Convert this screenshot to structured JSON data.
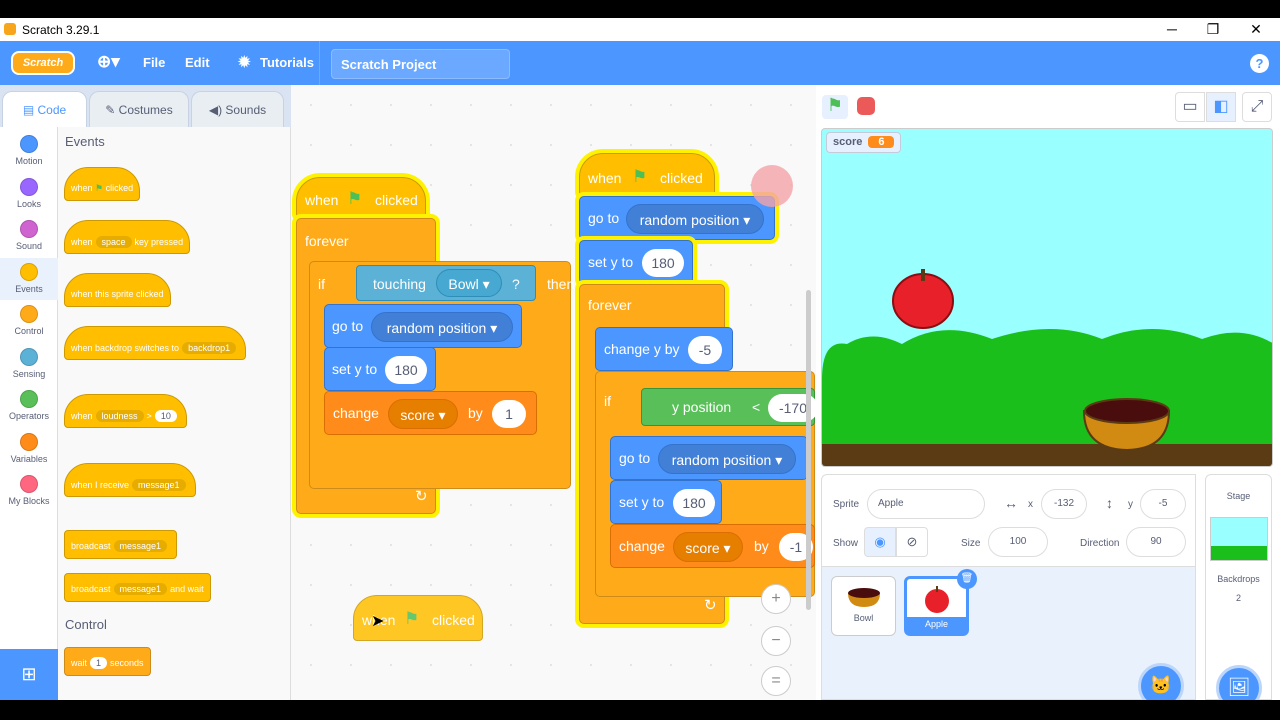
{
  "window": {
    "title": "Scratch 3.29.1",
    "minimize": "─",
    "restore": "❐",
    "close": "✕"
  },
  "menubar": {
    "logo": "Scratch",
    "language_icon": "globe-icon",
    "file": "File",
    "edit": "Edit",
    "tutorials": "Tutorials",
    "project_title": "Scratch Project",
    "help": "?"
  },
  "tabs": {
    "code": "Code",
    "costumes": "Costumes",
    "sounds": "Sounds"
  },
  "categories": [
    {
      "label": "Motion",
      "color": "#4c97ff"
    },
    {
      "label": "Looks",
      "color": "#9966ff"
    },
    {
      "label": "Sound",
      "color": "#cf63cf"
    },
    {
      "label": "Events",
      "color": "#ffbf00"
    },
    {
      "label": "Control",
      "color": "#ffab19"
    },
    {
      "label": "Sensing",
      "color": "#5cb1d6"
    },
    {
      "label": "Operators",
      "color": "#59c059"
    },
    {
      "label": "Variables",
      "color": "#ff8c1a"
    },
    {
      "label": "My Blocks",
      "color": "#ff6680"
    }
  ],
  "palette": {
    "events_heading": "Events",
    "control_heading": "Control",
    "b1": {
      "a": "when",
      "b": "clicked"
    },
    "b2": {
      "a": "when",
      "key": "space",
      "b": "key pressed"
    },
    "b3": {
      "a": "when this sprite clicked"
    },
    "b4": {
      "a": "when backdrop switches to",
      "opt": "backdrop1"
    },
    "b5": {
      "a": "when",
      "opt": "loudness",
      "op": ">",
      "val": "10"
    },
    "b6": {
      "a": "when I receive",
      "opt": "message1"
    },
    "b7": {
      "a": "broadcast",
      "opt": "message1"
    },
    "b8": {
      "a": "broadcast",
      "opt": "message1",
      "b": "and wait"
    },
    "b9": {
      "a": "wait",
      "val": "1",
      "b": "seconds"
    }
  },
  "script1": {
    "hat_a": "when",
    "hat_b": "clicked",
    "forever": "forever",
    "if": "if",
    "touching": "touching",
    "touching_opt": "Bowl",
    "q": "?",
    "then": "then",
    "goto": "go to",
    "goto_opt": "random position",
    "sety": "set y to",
    "sety_val": "180",
    "change": "change",
    "change_var": "score",
    "by": "by",
    "change_val": "1"
  },
  "script2": {
    "hat_a": "when",
    "hat_b": "clicked",
    "goto": "go to",
    "goto_opt": "random position",
    "sety": "set y to",
    "sety_val": "180",
    "forever": "forever",
    "changey": "change y by",
    "changey_val": "-5",
    "if": "if",
    "ypos": "y position",
    "lt": "<",
    "ltval": "-170",
    "goto2": "go to",
    "goto2_opt": "random position",
    "sety2": "set y to",
    "sety2_val": "180",
    "change": "change",
    "change_var": "score",
    "by": "by",
    "change_val": "-1"
  },
  "dragged": {
    "a": "when",
    "b": "clicked"
  },
  "zoom": {
    "in": "+",
    "out": "−",
    "reset": "="
  },
  "stage": {
    "score_label": "score",
    "score_value": "6"
  },
  "sprite_info": {
    "sprite_label": "Sprite",
    "sprite_name": "Apple",
    "x_label": "x",
    "x": "-132",
    "y_label": "y",
    "y": "-5",
    "show_label": "Show",
    "size_label": "Size",
    "size": "100",
    "direction_label": "Direction",
    "direction": "90"
  },
  "sprites": [
    {
      "name": "Bowl"
    },
    {
      "name": "Apple"
    }
  ],
  "stage_panel": {
    "title": "Stage",
    "backdrops_label": "Backdrops",
    "backdrops_count": "2"
  }
}
